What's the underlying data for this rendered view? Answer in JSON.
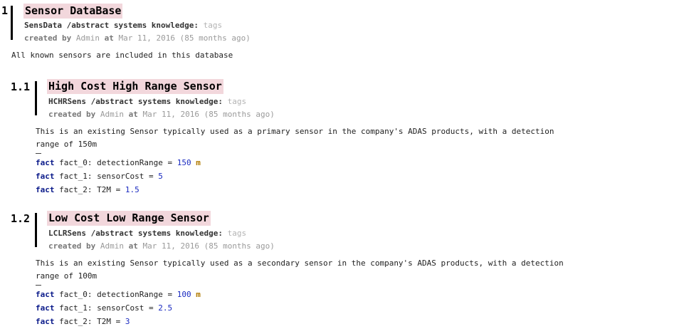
{
  "sections": [
    {
      "number": "1",
      "title": "Sensor DataBase",
      "id_path": "SensData /abstract systems knowledge:",
      "tags": "tags",
      "created_by_label": "created by",
      "author": "Admin",
      "at_label": "at",
      "date": "Mar 11, 2016 (85 months ago)",
      "description": "All known sensors are included in this database"
    },
    {
      "number": "1.1",
      "title": "High Cost High Range Sensor",
      "id_path": "HCHRSens /abstract systems knowledge:",
      "tags": "tags",
      "created_by_label": "created by",
      "author": "Admin",
      "at_label": "at",
      "date": "Mar 11, 2016 (85 months ago)",
      "description_line1": "This is an existing Sensor typically used as a primary sensor in the company's ADAS products, with a detection",
      "description_line2": "range of 150m",
      "facts": [
        {
          "keyword": "fact",
          "name": "fact_0: detectionRange =",
          "value": "150",
          "unit": "m"
        },
        {
          "keyword": "fact",
          "name": "fact_1: sensorCost =",
          "value": "5",
          "unit": ""
        },
        {
          "keyword": "fact",
          "name": "fact_2: T2M =",
          "value": "1.5",
          "unit": ""
        }
      ]
    },
    {
      "number": "1.2",
      "title": "Low Cost Low Range Sensor",
      "id_path": "LCLRSens /abstract systems knowledge:",
      "tags": "tags",
      "created_by_label": "created by",
      "author": "Admin",
      "at_label": "at",
      "date": "Mar 11, 2016 (85 months ago)",
      "description_line1": "This is an existing Sensor typically used as a secondary sensor in the company's ADAS products, with a detection",
      "description_line2": "range of 100m",
      "facts": [
        {
          "keyword": "fact",
          "name": "fact_0: detectionRange =",
          "value": "100",
          "unit": "m"
        },
        {
          "keyword": "fact",
          "name": "fact_1: sensorCost =",
          "value": "2.5",
          "unit": ""
        },
        {
          "keyword": "fact",
          "name": "fact_2: T2M =",
          "value": "3",
          "unit": ""
        }
      ]
    }
  ]
}
